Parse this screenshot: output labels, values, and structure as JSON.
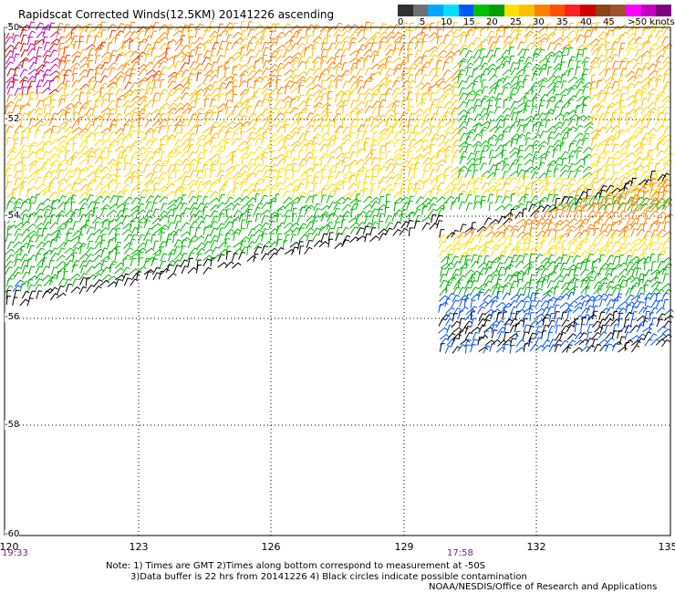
{
  "title": "Rapidscat Corrected Winds(12.5KM) 20141226 ascending",
  "legend": {
    "colors": [
      "#303030",
      "#707070",
      "#00a8ff",
      "#00e0ff",
      "#0058ff",
      "#00c000",
      "#00a000",
      "#ffe000",
      "#ffc000",
      "#ff8000",
      "#ff5000",
      "#ff2020",
      "#d00000",
      "#8b4513",
      "#a0522d",
      "#ff00ff",
      "#c000c0",
      "#800080"
    ],
    "labels": [
      "0",
      "5",
      "10",
      "15",
      "20",
      "25",
      "30",
      "35",
      "40",
      "45",
      ">50 knots"
    ]
  },
  "map": {
    "lat_labels": [
      "-50",
      "-52",
      "-54",
      "-56",
      "-58",
      "-60"
    ],
    "lon_labels": [
      "120",
      "123",
      "126",
      "129",
      "132",
      "135"
    ],
    "time_labels": [
      "19:33",
      "17:58"
    ]
  },
  "notes": [
    "Note: 1) Times are GMT 2)Times along bottom correspond to measurement at -50S",
    "3)Data buffer is 22 hrs from 20141226 4) Black circles indicate possible contamination",
    "NOAA/NESDIS/Office of Research and Applications"
  ]
}
